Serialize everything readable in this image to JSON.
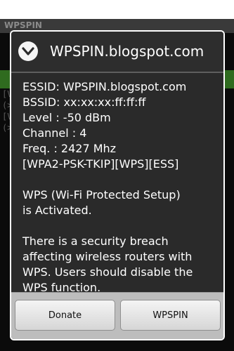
{
  "background_app": {
    "title": "WPSPIN",
    "list_lines": [
      "[V",
      "(>",
      "[V",
      "(>"
    ]
  },
  "dialog": {
    "title": "WPSPIN.blogspot.com",
    "icon": "chevron-down-circle-icon",
    "lines": [
      "ESSID: WPSPIN.blogspot.com",
      "BSSID: xx:xx:xx:ff:ff:ff",
      "Level : -50 dBm",
      "Channel : 4",
      "Freq. : 2427 Mhz",
      "[WPA2-PSK-TKIP][WPS][ESS]",
      "",
      "WPS (Wi-Fi Protected Setup)",
      "is Activated.",
      "",
      "There is a security breach",
      "affecting wireless routers with",
      "WPS. Users should disable the",
      "WPS function."
    ],
    "buttons": {
      "donate": "Donate",
      "wpspin": "WPSPIN"
    }
  }
}
